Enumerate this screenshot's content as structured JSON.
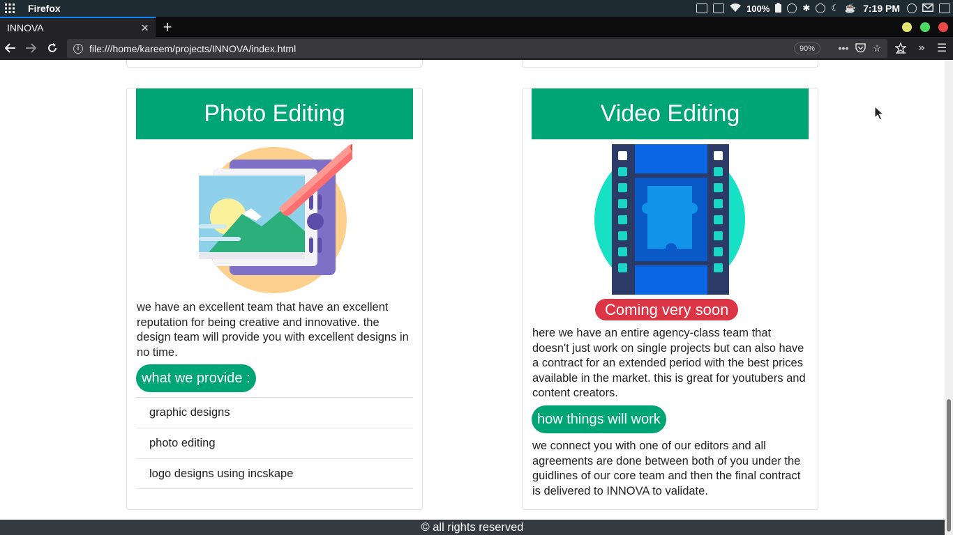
{
  "system": {
    "app_name": "Firefox",
    "battery": "100%",
    "clock": "7:19 PM"
  },
  "browser": {
    "tab_title": "INNOVA",
    "tab_close": "×",
    "new_tab": "+",
    "url": "file:///home/kareem/projects/INNOVA/index.html",
    "zoom": "90%",
    "window_colors": {
      "minimize": "#e5e572",
      "maximize": "#4bd964",
      "close": "#ee4747"
    }
  },
  "cards": [
    {
      "title": "Photo Editing",
      "description": "we have an excellent team that have an excellent reputation for being creative and innovative. the design team will provide you with excellent designs in no time.",
      "pill": "what we provide :",
      "items": [
        "graphic designs",
        "photo editing",
        "logo designs using incskape"
      ]
    },
    {
      "title": "Video Editing",
      "badge": "Coming very soon",
      "description": "here we have an entire agency-class team that doesn't just work on single projects but can also have a contract for an extended period with the best prices available in the market. this is great for youtubers and content creators.",
      "pill": "how things will work",
      "details": "we connect you with one of our editors and all agreements are done between both of you under the guidlines of our core team and then the final contract is delivered to INNOVA to validate."
    }
  ],
  "footer": "© all rights reserved",
  "colors": {
    "accent": "#00a575",
    "danger": "#dc3545",
    "footer_bg": "#343a40"
  }
}
